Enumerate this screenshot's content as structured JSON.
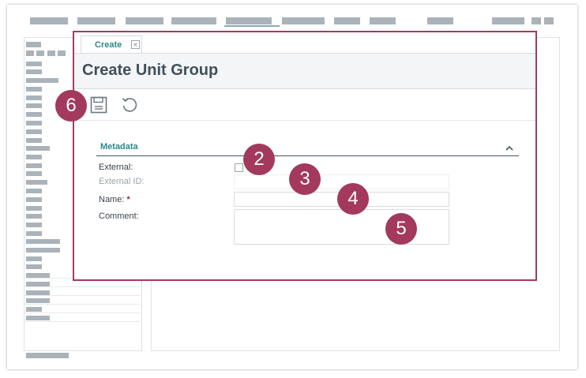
{
  "dialog": {
    "tab_label": "Create",
    "title": "Create Unit Group"
  },
  "toolbar": {
    "save_icon": "save-icon",
    "reset_icon": "undo-icon"
  },
  "form": {
    "section_title": "Metadata",
    "external_label": "External:",
    "external_id_label": "External ID:",
    "name_label": "Name:",
    "required_marker": "*",
    "comment_label": "Comment:",
    "external_checked": false,
    "external_id_value": "",
    "name_value": "",
    "comment_value": ""
  },
  "callouts": {
    "save": "6",
    "external": "2",
    "external_id": "3",
    "name": "4",
    "comment": "5"
  },
  "colors": {
    "accent": "#2a8a8a",
    "callout": "#a3395d",
    "highlight_border": "#a23b61",
    "title": "#3f505b"
  }
}
